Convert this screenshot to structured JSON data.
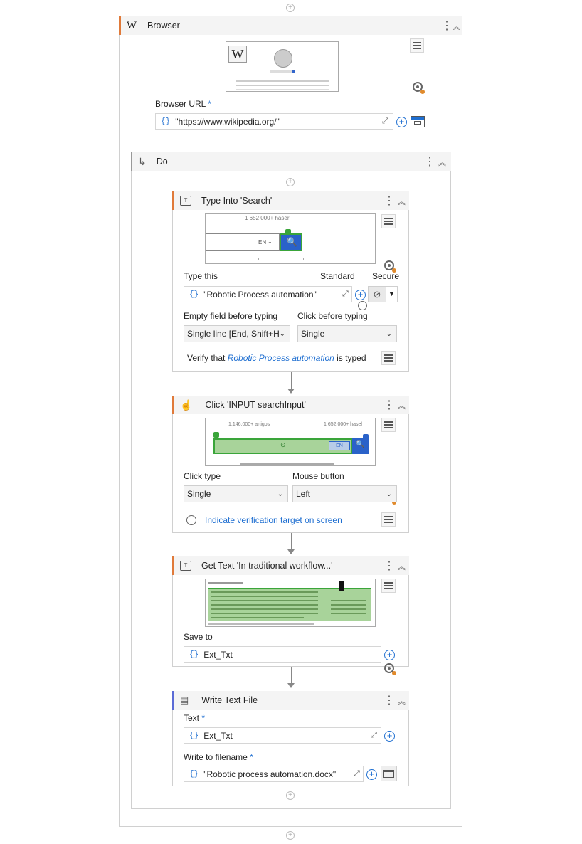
{
  "browser": {
    "title": "Browser",
    "logo_letter": "W",
    "url_label": "Browser URL",
    "required_mark": "*",
    "url_value": "\"https://www.wikipedia.org/\""
  },
  "do_block": {
    "title": "Do"
  },
  "type_into": {
    "title": "Type Into 'Search'",
    "preview_text": "1 652 000+ haser",
    "preview_lang": "EN",
    "type_this_label": "Type this",
    "mode_standard": "Standard",
    "mode_secure": "Secure",
    "value": "\"Robotic Process automation\"",
    "empty_field_label": "Empty field before typing",
    "empty_field_value": "Single line [End, Shift+H",
    "click_before_label": "Click before typing",
    "click_before_value": "Single",
    "verify_prefix": "Verify that",
    "verify_value": "Robotic Process automation",
    "verify_suffix": "is typed"
  },
  "click": {
    "title": "Click 'INPUT searchInput'",
    "preview_left": "1,146,000+ artigos",
    "preview_right": "1 652 000+ hasel",
    "preview_lang": "EN",
    "click_type_label": "Click type",
    "click_type_value": "Single",
    "mouse_button_label": "Mouse button",
    "mouse_button_value": "Left",
    "indicate_text": "Indicate verification target on screen"
  },
  "get_text": {
    "title": "Get Text 'In traditional workflow...'",
    "save_to_label": "Save to",
    "save_to_value": "Ext_Txt"
  },
  "write_file": {
    "title": "Write Text File",
    "text_label": "Text",
    "text_value": "Ext_Txt",
    "filename_label": "Write to filename",
    "filename_value": "\"Robotic process automation.docx\""
  },
  "icons": {
    "add": "add-activity-icon",
    "menu": "hamburger-menu-icon",
    "target": "target-icon",
    "more": "more-options-icon",
    "collapse": "collapse-icon"
  }
}
